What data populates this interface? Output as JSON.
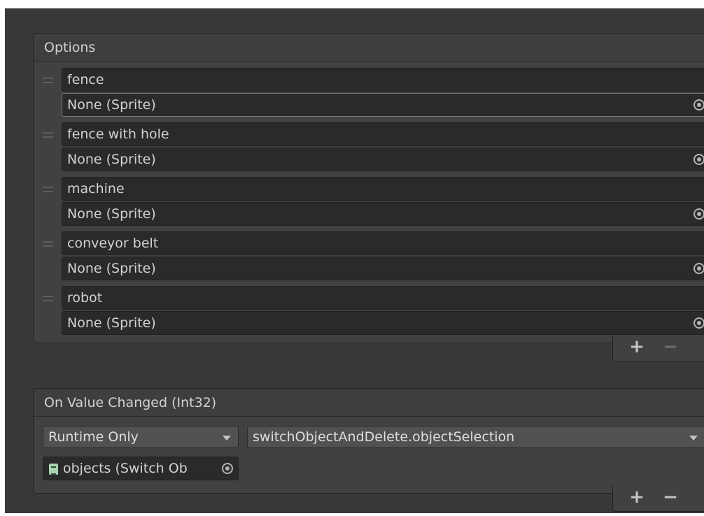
{
  "options": {
    "title": "Options",
    "items": [
      {
        "label": "fence",
        "sprite": "None (Sprite)"
      },
      {
        "label": "fence with hole",
        "sprite": "None (Sprite)"
      },
      {
        "label": "machine",
        "sprite": "None (Sprite)"
      },
      {
        "label": "conveyor belt",
        "sprite": "None (Sprite)"
      },
      {
        "label": "robot",
        "sprite": "None (Sprite)"
      }
    ],
    "add_label": "+",
    "remove_label": "−"
  },
  "on_value_changed": {
    "title": "On Value Changed (Int32)",
    "runtime_dropdown": "Runtime Only",
    "function_dropdown": "switchObjectAndDelete.objectSelection",
    "object_field": "objects (Switch Ob",
    "add_label": "+",
    "remove_label": "−"
  },
  "icons": {
    "drag_handle": "drag-handle-icon",
    "picker": "object-picker-icon",
    "script": "script-icon",
    "dropdown": "chevron-down-icon"
  },
  "colors": {
    "panel_bg": "#414141",
    "field_bg": "#2a2a2a",
    "text": "#d2d2d2"
  }
}
